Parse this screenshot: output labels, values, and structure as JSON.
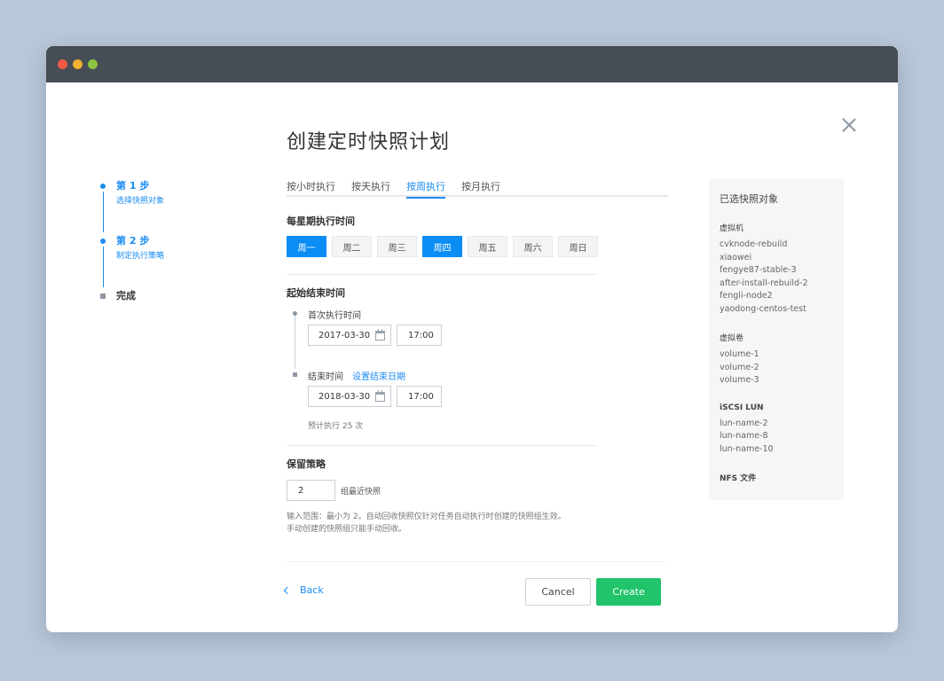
{
  "window": {
    "title": "创建定时快照计划"
  },
  "steps": [
    {
      "title": "第 1 步",
      "subtitle": "选择快照对象"
    },
    {
      "title": "第 2 步",
      "subtitle": "制定执行策略"
    },
    {
      "title": "完成",
      "subtitle": ""
    }
  ],
  "tabs": [
    {
      "label": "按小时执行",
      "active": false
    },
    {
      "label": "按天执行",
      "active": false
    },
    {
      "label": "按周执行",
      "active": true
    },
    {
      "label": "按月执行",
      "active": false
    }
  ],
  "weekly": {
    "label": "每星期执行时间",
    "days": [
      {
        "label": "周一",
        "selected": true
      },
      {
        "label": "周二",
        "selected": false
      },
      {
        "label": "周三",
        "selected": false
      },
      {
        "label": "周四",
        "selected": true
      },
      {
        "label": "周五",
        "selected": false
      },
      {
        "label": "周六",
        "selected": false
      },
      {
        "label": "周日",
        "selected": false
      }
    ]
  },
  "schedule": {
    "label": "起始结束时间",
    "first_label": "首次执行时间",
    "first_date": "2017-03-30",
    "first_time": "17:00",
    "end_label": "结束时间",
    "end_link": "设置结束日期",
    "end_date": "2018-03-30",
    "end_time": "17:00",
    "estimate": "预计执行 25 次"
  },
  "retention": {
    "label": "保留策略",
    "value": "2",
    "unit": "组最近快照",
    "hint_line1": "输入范围：最小为 2。自动回收快照仅针对任务自动执行时创建的快照组生效。",
    "hint_line2": "手动创建的快照组只能手动回收。"
  },
  "footer": {
    "back_label": "Back",
    "cancel_label": "Cancel",
    "create_label": "Create"
  },
  "panel": {
    "title": "已选快照对象",
    "groups": [
      {
        "title": "虚拟机",
        "items": [
          "cvknode-rebuild",
          "xiaowei",
          "fengye87-stable-3",
          "after-install-rebuild-2",
          "fengli-node2",
          "yaodong-centos-test"
        ]
      },
      {
        "title": "虚拟卷",
        "items": [
          "volume-1",
          "volume-2",
          "volume-3"
        ]
      },
      {
        "title": "iSCSI LUN",
        "items": [
          "lun-name-2",
          "lun-name-8",
          "lun-name-10"
        ]
      },
      {
        "title": "NFS 文件",
        "items": []
      }
    ]
  },
  "colors": {
    "primary": "#0a8df5",
    "create": "#21c46a",
    "titlebar": "#474d55",
    "background": "#b9c8d9"
  }
}
